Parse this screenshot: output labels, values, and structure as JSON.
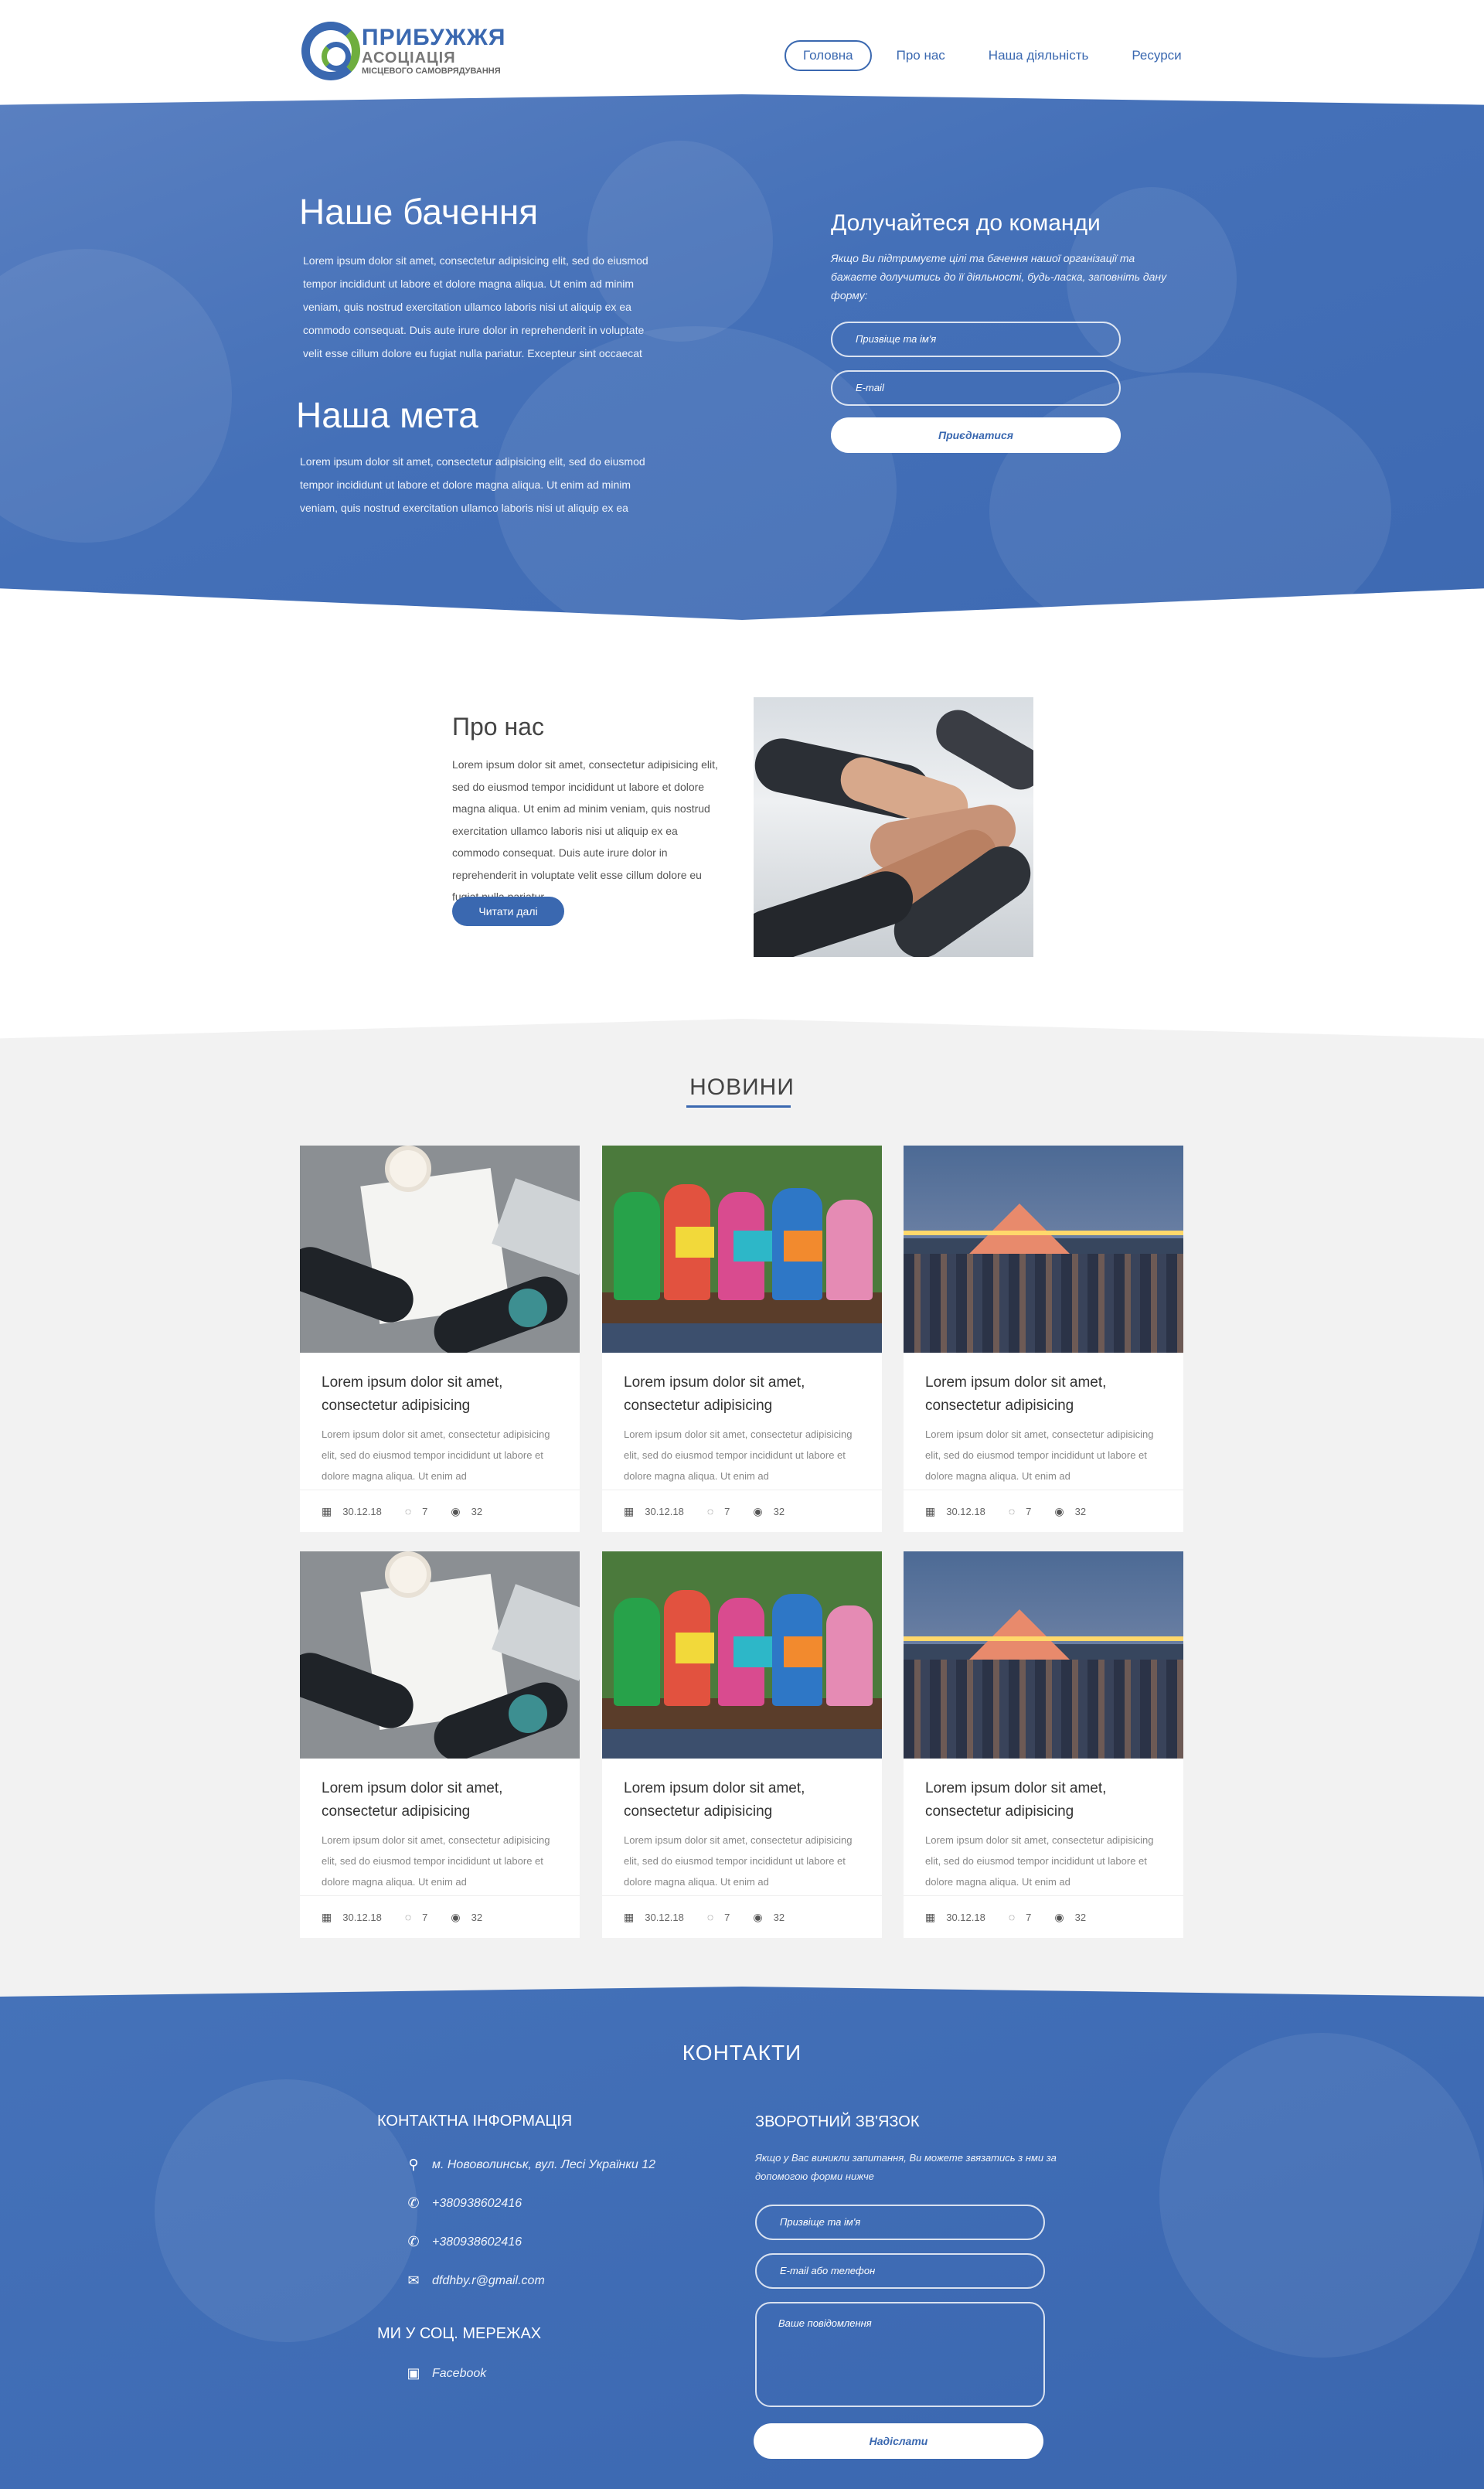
{
  "header": {
    "logo": {
      "line1": "ПРИБУЖЖЯ",
      "line2": "АСОЦІАЦІЯ",
      "line3": "МІСЦЕВОГО САМОВРЯДУВАННЯ"
    },
    "nav": [
      "Головна",
      "Про нас",
      "Наша діяльність",
      "Ресурси"
    ]
  },
  "hero": {
    "vision_title": "Наше бачення",
    "vision_text": "Lorem ipsum dolor sit amet, consectetur adipisicing elit, sed do eiusmod tempor incididunt ut labore et dolore magna aliqua. Ut enim ad minim veniam, quis nostrud exercitation ullamco laboris nisi ut aliquip ex ea commodo consequat. Duis aute irure dolor in reprehenderit in voluptate velit esse cillum dolore eu fugiat nulla pariatur. Excepteur sint occaecat",
    "goal_title": "Наша мета",
    "goal_text": "Lorem ipsum dolor sit amet, consectetur adipisicing elit, sed do eiusmod tempor incididunt ut labore et dolore magna aliqua. Ut enim ad minim veniam, quis nostrud exercitation ullamco laboris nisi ut aliquip ex ea",
    "join_title": "Долучайтеся до команди",
    "join_text": "Якщо Ви підтримуєте цілі та бачення нашої організації та бажаєте долучитись до її діяльності, будь-ласка, заповніть дану форму:",
    "name_placeholder": "Призвіще та ім'я",
    "email_placeholder": "E-mail",
    "join_button": "Приєднатися"
  },
  "about": {
    "title": "Про нас",
    "text": "Lorem ipsum dolor sit amet, consectetur adipisicing elit, sed do eiusmod tempor incididunt ut labore et dolore magna aliqua. Ut enim ad minim veniam, quis nostrud exercitation ullamco laboris nisi ut aliquip ex ea commodo consequat. Duis aute irure dolor in reprehenderit in voluptate velit esse cillum dolore eu fugiat nulla pariatur.",
    "button": "Читати далі"
  },
  "news": {
    "title": "НОВИНИ",
    "cards": [
      {
        "title": "Lorem ipsum dolor sit amet, consectetur adipisicing",
        "text": "Lorem ipsum dolor sit amet, consectetur adipisicing elit, sed do eiusmod tempor incididunt ut labore et dolore magna aliqua. Ut enim ad",
        "date": "30.12.18",
        "comments": "7",
        "views": "32"
      },
      {
        "title": "Lorem ipsum dolor sit amet, consectetur adipisicing",
        "text": "Lorem ipsum dolor sit amet, consectetur adipisicing elit, sed do eiusmod tempor incididunt ut labore et dolore magna aliqua. Ut enim ad",
        "date": "30.12.18",
        "comments": "7",
        "views": "32"
      },
      {
        "title": "Lorem ipsum dolor sit amet, consectetur adipisicing",
        "text": "Lorem ipsum dolor sit amet, consectetur adipisicing elit, sed do eiusmod tempor incididunt ut labore et dolore magna aliqua. Ut enim ad",
        "date": "30.12.18",
        "comments": "7",
        "views": "32"
      },
      {
        "title": "Lorem ipsum dolor sit amet, consectetur adipisicing",
        "text": "Lorem ipsum dolor sit amet, consectetur adipisicing elit, sed do eiusmod tempor incididunt ut labore et dolore magna aliqua. Ut enim ad",
        "date": "30.12.18",
        "comments": "7",
        "views": "32"
      },
      {
        "title": "Lorem ipsum dolor sit amet, consectetur adipisicing",
        "text": "Lorem ipsum dolor sit amet, consectetur adipisicing elit, sed do eiusmod tempor incididunt ut labore et dolore magna aliqua. Ut enim ad",
        "date": "30.12.18",
        "comments": "7",
        "views": "32"
      },
      {
        "title": "Lorem ipsum dolor sit amet, consectetur adipisicing",
        "text": "Lorem ipsum dolor sit amet, consectetur adipisicing elit, sed do eiusmod tempor incididunt ut labore et dolore magna aliqua. Ut enim ad",
        "date": "30.12.18",
        "comments": "7",
        "views": "32"
      }
    ]
  },
  "contacts": {
    "title": "КОНТАКТИ",
    "info_title": "КОНТАКТНА ІНФОРМАЦІЯ",
    "address": "м. Нововолинськ, вул. Лесі Українки 12",
    "phone1": "+380938602416",
    "phone2": "+380938602416",
    "email": "dfdhby.r@gmail.com",
    "social_title": "МИ У СОЦ. МЕРЕЖАХ",
    "facebook": "Facebook",
    "feedback_title": "ЗВОРОТНИЙ ЗВ'ЯЗОК",
    "feedback_text": "Якщо у Вас виникли запитання, Ви можете звязатись з нми за допомогою форми нижче",
    "name_placeholder": "Призвіще та ім'я",
    "contact_placeholder": "E-mail або телефон",
    "message_placeholder": "Ваше повідомлення",
    "send_button": "Надіслати"
  },
  "colors": {
    "brand_blue": "#3a68b0",
    "brand_green": "#6fae3e",
    "news_bg": "#f2f2f2"
  }
}
